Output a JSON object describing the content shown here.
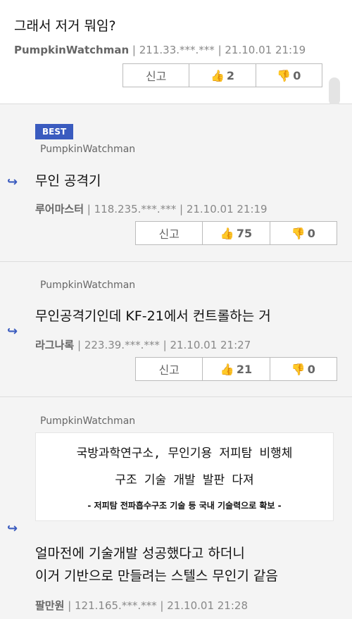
{
  "comments": [
    {
      "text": "그래서 저거 뭐임?",
      "author": "PumpkinWatchman",
      "ip": "211.33.***.***",
      "date": "21.10.01 21:19",
      "report_label": "신고",
      "up_count": "2",
      "down_count": "0"
    },
    {
      "badge": "BEST",
      "mention": "PumpkinWatchman",
      "text": "무인 공격기",
      "author": "루어마스터",
      "ip": "118.235.***.***",
      "date": "21.10.01 21:19",
      "report_label": "신고",
      "up_count": "75",
      "down_count": "0"
    },
    {
      "mention": "PumpkinWatchman",
      "text": "무인공격기인데 KF-21에서 컨트롤하는 거",
      "author": "라그나록",
      "ip": "223.39.***.***",
      "date": "21.10.01 21:27",
      "report_label": "신고",
      "up_count": "21",
      "down_count": "0"
    },
    {
      "mention": "PumpkinWatchman",
      "image_lines": [
        "국방과학연구소, 무인기용 저피탐 비행체",
        "구조 기술 개발 발판 다져",
        "- 저피탐 전파흡수구조 기술 등 국내 기술력으로 확보 -"
      ],
      "text_line1": "얼마전에 기술개발 성공했다고 하더니",
      "text_line2": "이거 기반으로 만들려는 스텔스 무인기 같음",
      "author": "팔만원",
      "ip": "121.165.***.***",
      "date": "21.10.01 21:28"
    }
  ],
  "icons": {
    "thumb_up": "thumbs-up-icon",
    "thumb_down": "thumbs-down-icon",
    "reply_arrow": "reply-arrow-icon"
  },
  "colors": {
    "up": "#e05a5a",
    "down": "#3a5bbf",
    "best_badge": "#3a5bbf"
  }
}
